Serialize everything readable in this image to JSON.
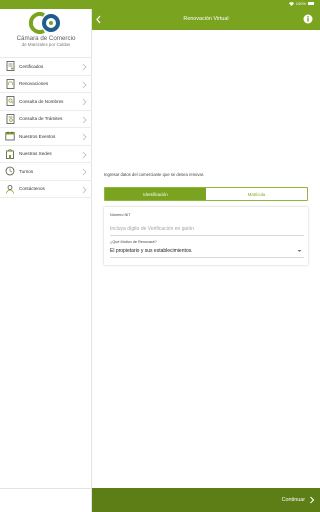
{
  "status_bar": {
    "battery": "100%"
  },
  "logo": {
    "line1": "Cámara de Comercio",
    "line2": "de Manizales por Caldas"
  },
  "menu": [
    {
      "label": "Certificados",
      "icon": "certificate-icon"
    },
    {
      "label": "Renovaciones",
      "icon": "renewal-icon"
    },
    {
      "label": "Consulta de Nombres",
      "icon": "name-search-icon"
    },
    {
      "label": "Consulta de Trámites",
      "icon": "procedure-search-icon"
    },
    {
      "label": "Nuestros Eventos",
      "icon": "calendar-icon"
    },
    {
      "label": "Nuestras Sedes",
      "icon": "building-icon"
    },
    {
      "label": "Turnos",
      "icon": "turns-icon"
    },
    {
      "label": "Contáctenos",
      "icon": "contact-icon"
    }
  ],
  "header": {
    "title": "Renovación Virtual"
  },
  "instruction": "Ingresar datos del comerciante que se desea renovar.",
  "tabs": {
    "active": "Identificación",
    "inactive": "Matrícula"
  },
  "form": {
    "nit_label": "Número NIT",
    "nit_placeholder": "Incluya dígito de Verificación en guión",
    "reason_label": "¿Qué Motivo de Renovará?",
    "reason_value": "El propietario y sus establecimientos."
  },
  "footer": {
    "continue_label": "Continuar"
  },
  "colors": {
    "accent": "#7aa41f",
    "footer": "#5d7d16",
    "logo_blue": "#1f5d8a"
  }
}
